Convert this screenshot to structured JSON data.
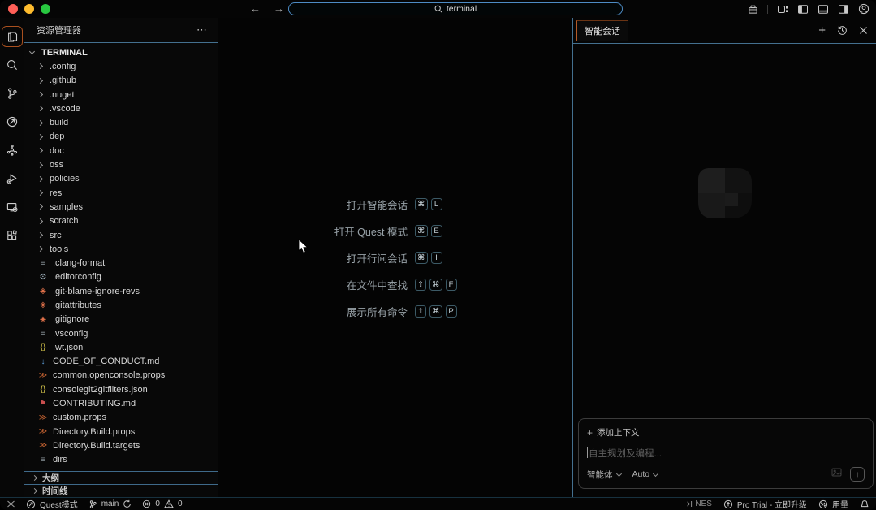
{
  "titlebar": {
    "search_value": "terminal",
    "nav_back": "←",
    "nav_forward": "→",
    "right_icons": [
      "gift-icon",
      "editor-groups-icon",
      "toggle-left-sidebar-icon",
      "toggle-bottom-panel-icon",
      "toggle-right-sidebar-icon",
      "account-icon"
    ]
  },
  "activity_bar": {
    "items": [
      "explorer",
      "search",
      "source-control",
      "quest-mode",
      "agents",
      "run-debug",
      "remote-explorer",
      "extensions"
    ],
    "active": "explorer",
    "active_border_color": "#a9501f"
  },
  "sidebar": {
    "title": "资源管理器",
    "more": "⋯",
    "root_label": "TERMINAL",
    "tree": [
      {
        "label": ".config",
        "kind": "folder"
      },
      {
        "label": ".github",
        "kind": "folder"
      },
      {
        "label": ".nuget",
        "kind": "folder"
      },
      {
        "label": ".vscode",
        "kind": "folder"
      },
      {
        "label": "build",
        "kind": "folder"
      },
      {
        "label": "dep",
        "kind": "folder"
      },
      {
        "label": "doc",
        "kind": "folder"
      },
      {
        "label": "oss",
        "kind": "folder"
      },
      {
        "label": "policies",
        "kind": "folder"
      },
      {
        "label": "res",
        "kind": "folder"
      },
      {
        "label": "samples",
        "kind": "folder"
      },
      {
        "label": "scratch",
        "kind": "folder"
      },
      {
        "label": "src",
        "kind": "folder"
      },
      {
        "label": "tools",
        "kind": "folder"
      },
      {
        "label": ".clang-format",
        "kind": "file",
        "icon": "lines",
        "color": "#8a9399"
      },
      {
        "label": ".editorconfig",
        "kind": "file",
        "icon": "gear",
        "color": "#9fb0bb"
      },
      {
        "label": ".git-blame-ignore-revs",
        "kind": "file",
        "icon": "git",
        "color": "#de7049"
      },
      {
        "label": ".gitattributes",
        "kind": "file",
        "icon": "git",
        "color": "#de7049"
      },
      {
        "label": ".gitignore",
        "kind": "file",
        "icon": "git",
        "color": "#de7049"
      },
      {
        "label": ".vsconfig",
        "kind": "file",
        "icon": "lines",
        "color": "#8a9399"
      },
      {
        "label": ".wt.json",
        "kind": "file",
        "icon": "json",
        "color": "#d8c84c"
      },
      {
        "label": "CODE_OF_CONDUCT.md",
        "kind": "file",
        "icon": "mddown",
        "color": "#5b9bd5"
      },
      {
        "label": "common.openconsole.props",
        "kind": "file",
        "icon": "props",
        "color": "#cc6633"
      },
      {
        "label": "consolegit2gitfilters.json",
        "kind": "file",
        "icon": "json",
        "color": "#d8c84c"
      },
      {
        "label": "CONTRIBUTING.md",
        "kind": "file",
        "icon": "flag",
        "color": "#c94f4f"
      },
      {
        "label": "custom.props",
        "kind": "file",
        "icon": "props",
        "color": "#cc6633"
      },
      {
        "label": "Directory.Build.props",
        "kind": "file",
        "icon": "props",
        "color": "#cc6633"
      },
      {
        "label": "Directory.Build.targets",
        "kind": "file",
        "icon": "props",
        "color": "#cc6633"
      },
      {
        "label": "dirs",
        "kind": "file",
        "icon": "lines",
        "color": "#8a9399"
      }
    ],
    "sections": [
      {
        "label": "大纲"
      },
      {
        "label": "时间线"
      }
    ]
  },
  "icons": {
    "lines": "≡",
    "gear": "⚙",
    "git": "◈",
    "json": "{}",
    "mddown": "↓",
    "props": "≫",
    "flag": "⚑"
  },
  "editor": {
    "shortcuts": [
      {
        "label": "打开智能会话",
        "keys": [
          "⌘",
          "L"
        ]
      },
      {
        "label": "打开 Quest 模式",
        "keys": [
          "⌘",
          "E"
        ]
      },
      {
        "label": "打开行间会话",
        "keys": [
          "⌘",
          "I"
        ]
      },
      {
        "label": "在文件中查找",
        "keys": [
          "⇧",
          "⌘",
          "F"
        ]
      },
      {
        "label": "展示所有命令",
        "keys": [
          "⇧",
          "⌘",
          "P"
        ]
      }
    ]
  },
  "chat": {
    "tab_label": "智能会话",
    "plus": "+",
    "add_context": "添加上下文",
    "placeholder": "自主规划及编程...",
    "agent_label": "智能体",
    "model_label": "Auto",
    "send": "↑"
  },
  "status_bar": {
    "quest_label": "Quest模式",
    "branch": "main",
    "errors": "0",
    "warnings": "0",
    "nes_label": "NES",
    "pro_label": "Pro Trial - 立即升级",
    "usage_label": "用量"
  },
  "colors": {
    "accent_orange": "#b35a28",
    "panel_border_blue": "#44708f",
    "search_border_blue": "#4d8bc4"
  }
}
